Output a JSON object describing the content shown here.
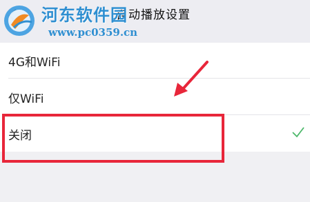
{
  "header": {
    "title": "自动播放设置",
    "back_icon": "chevron-left-icon"
  },
  "watermark": {
    "name": "河东软件园",
    "url": "www.pc0359.cn",
    "logo_icon": "hedong-logo-icon",
    "color": "#2f8fd1"
  },
  "options": [
    {
      "label": "4G和WiFi",
      "selected": false
    },
    {
      "label": "仅WiFi",
      "selected": false
    },
    {
      "label": "关闭",
      "selected": true
    }
  ],
  "annotation": {
    "box_color": "#e8263a",
    "arrow_color": "#e8263a"
  },
  "check_color": "#4cb86a"
}
